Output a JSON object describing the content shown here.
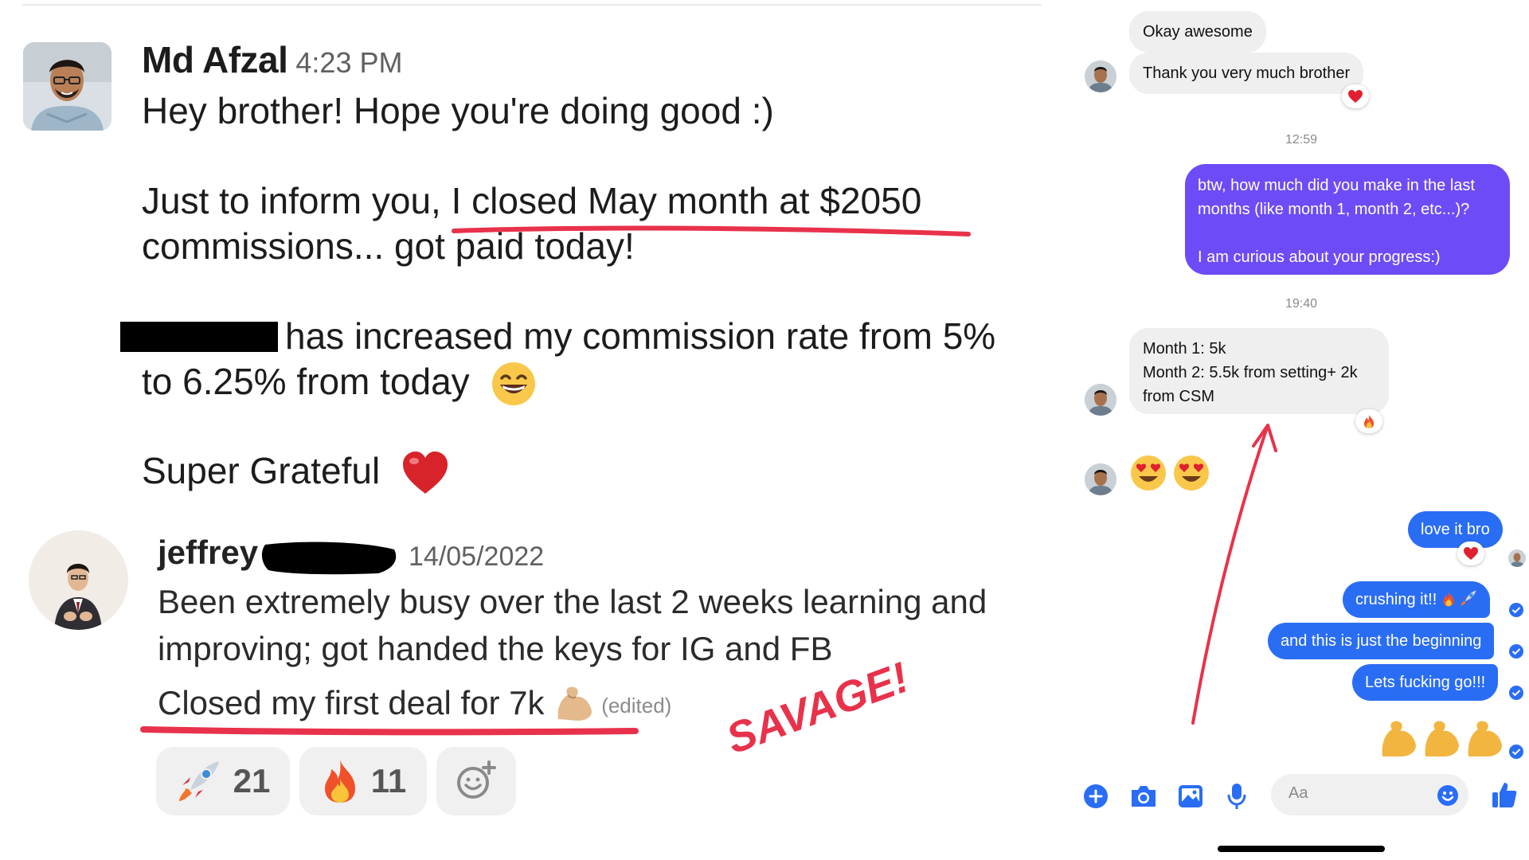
{
  "slack": {
    "message1": {
      "author": "Md Afzal",
      "time": "4:23 PM",
      "line1": "Hey brother! Hope you're doing good :)",
      "line2_prefix": "Just to inform you, ",
      "line2_highlight": "I closed May month at $2050",
      "line3": "commissions... got paid today!",
      "line4": "has increased my commission rate from 5%",
      "line5": "to 6.25% from today",
      "line6": "Super Grateful"
    },
    "message2": {
      "author": "jeffrey",
      "date": "14/05/2022",
      "line1": "Been extremely busy over the last 2 weeks learning and",
      "line2": "improving; got handed the keys for IG and FB",
      "line3": "Closed my first deal for 7k",
      "edited": "(edited)"
    },
    "reactions": [
      {
        "emoji": "rocket",
        "count": "21"
      },
      {
        "emoji": "fire",
        "count": "11"
      },
      {
        "emoji": "add-reaction"
      }
    ],
    "annotation": "SAVAGE!"
  },
  "messenger": {
    "messages": [
      {
        "text": "Okay awesome"
      },
      {
        "text": "Thank you very much brother"
      },
      {
        "text": "btw, how much did you make in the last months (like month 1, month 2, etc...)?"
      },
      {
        "text": "I am curious about your progress:)"
      },
      {
        "text": "Month 1: 5k"
      },
      {
        "text": "Month 2: 5.5k from setting+ 2k from CSM"
      },
      {
        "text": "love it bro"
      },
      {
        "text": "crushing it!! "
      },
      {
        "text": "and this is just the beginning"
      },
      {
        "text": "Lets fucking go!!!"
      }
    ],
    "timestamps": [
      "12:59",
      "19:40"
    ],
    "input_placeholder": "Aa",
    "colors": {
      "purple_bubble": "#6d4cf7",
      "blue_bubble": "#2a6df5",
      "incoming_bubble": "#efefef"
    }
  }
}
